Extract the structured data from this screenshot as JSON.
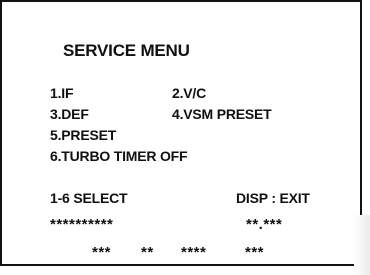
{
  "screen": {
    "title": "SERVICE MENU",
    "menu_items": [
      "1.IF",
      "2.V/C",
      "3.DEF",
      "4.VSM PRESET",
      "5.PRESET",
      "6.TURBO TIMER OFF"
    ],
    "footer": {
      "select_text": "1-6 SELECT",
      "exit_text": "DISP : EXIT"
    },
    "status_rows": {
      "row1_left": "**********",
      "row1_right": "**.***",
      "row2_groups": [
        "***",
        "**",
        "****",
        "***"
      ]
    }
  }
}
